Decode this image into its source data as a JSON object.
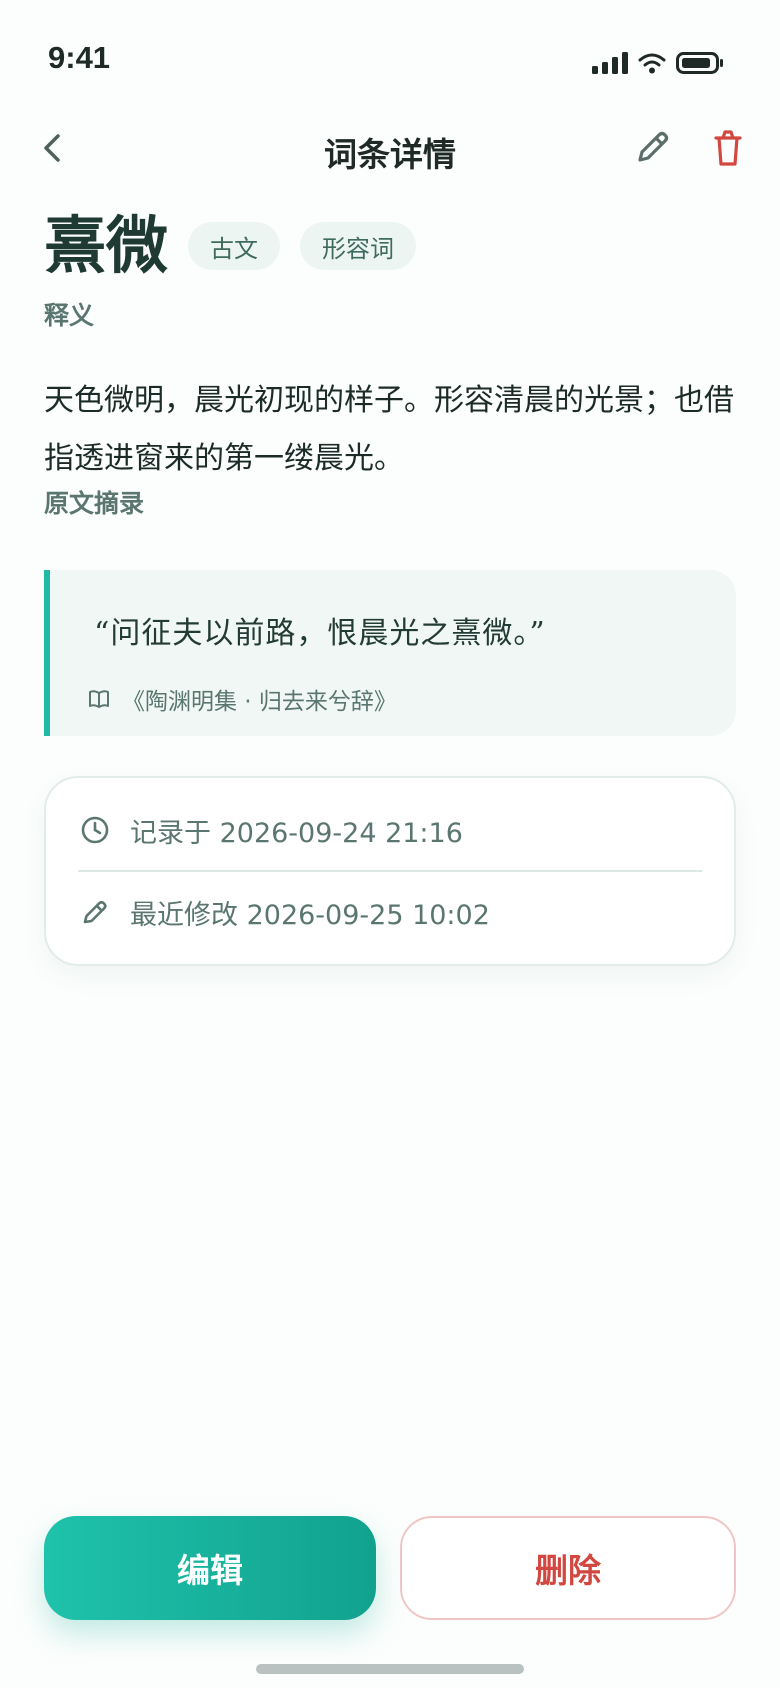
{
  "status": {
    "time": "9:41"
  },
  "nav": {
    "title": "词条详情"
  },
  "entry": {
    "headword": "熹微",
    "tags": [
      "古文",
      "形容词"
    ],
    "definition_label": "释义",
    "definition": "天色微明，晨光初现的样子。形容清晨的光景；也借指透进窗来的第一缕晨光。",
    "excerpt_label": "原文摘录",
    "excerpt": "“问征夫以前路，恨晨光之熹微。”",
    "source": "《陶渊明集 · 归去来兮辞》"
  },
  "meta": {
    "recorded": "记录于 2026-09-24 21:16",
    "modified": "最近修改 2026-09-25 10:02"
  },
  "actions": {
    "edit_label": "编辑",
    "delete_label": "删除"
  },
  "colors": {
    "accent": "#1fb9a4",
    "danger": "#d2473f"
  }
}
